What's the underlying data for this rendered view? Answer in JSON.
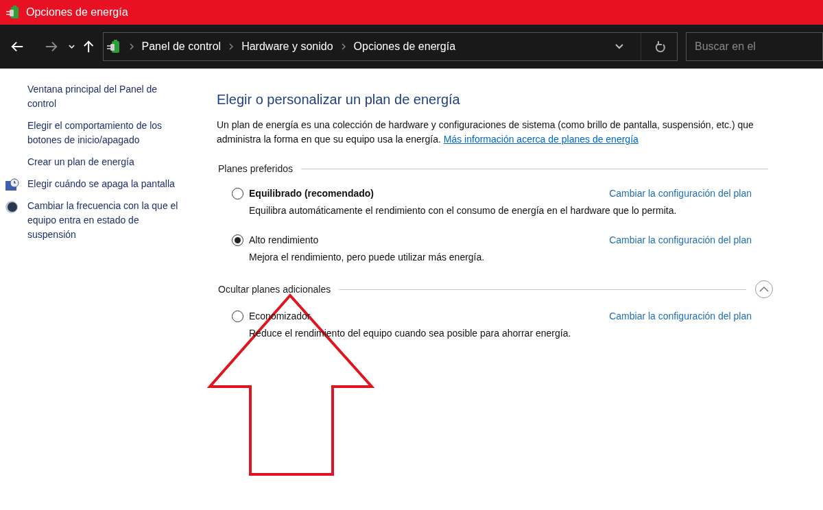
{
  "window": {
    "title": "Opciones de energía"
  },
  "breadcrumb": [
    "Panel de control",
    "Hardware y sonido",
    "Opciones de energía"
  ],
  "search": {
    "placeholder": "Buscar en el"
  },
  "sidebar": {
    "items": [
      {
        "label": "Ventana principal del Panel de control",
        "kind": "plain"
      },
      {
        "label": "Elegir el comportamiento de los botones de inicio/apagado",
        "kind": "plain"
      },
      {
        "label": "Crear un plan de energía",
        "kind": "plain"
      },
      {
        "label": "Elegir cuándo se apaga la pantalla",
        "kind": "display"
      },
      {
        "label": "Cambiar la frecuencia con la que el equipo entra en estado de suspensión",
        "kind": "sleep"
      }
    ]
  },
  "main": {
    "heading": "Elegir o personalizar un plan de energía",
    "intro": "Un plan de energía es una colección de hardware y configuraciones de sistema (como brillo de pantalla, suspensión, etc.) que administra la forma en que su equipo usa la energía.",
    "intro_link": "Más información acerca de planes de energía",
    "groups": [
      {
        "title": "Planes preferidos",
        "collapse_button": false,
        "plans": [
          {
            "name": "Equilibrado (recomendado)",
            "bold": true,
            "selected": false,
            "description": "Equilibra automáticamente el rendimiento con el consumo de energía en el hardware que lo permita.",
            "link": "Cambiar la configuración del plan"
          },
          {
            "name": "Alto rendimiento",
            "bold": false,
            "selected": true,
            "description": "Mejora el rendimiento, pero puede utilizar más energía.",
            "link": "Cambiar la configuración del plan"
          }
        ]
      },
      {
        "title": "Ocultar planes adicionales",
        "collapse_button": true,
        "plans": [
          {
            "name": "Economizador",
            "bold": false,
            "selected": false,
            "description": "Reduce el rendimiento del equipo cuando sea posible para ahorrar energía.",
            "link": "Cambiar la configuración del plan"
          }
        ]
      }
    ]
  },
  "annotation": {
    "kind": "up-arrow"
  }
}
